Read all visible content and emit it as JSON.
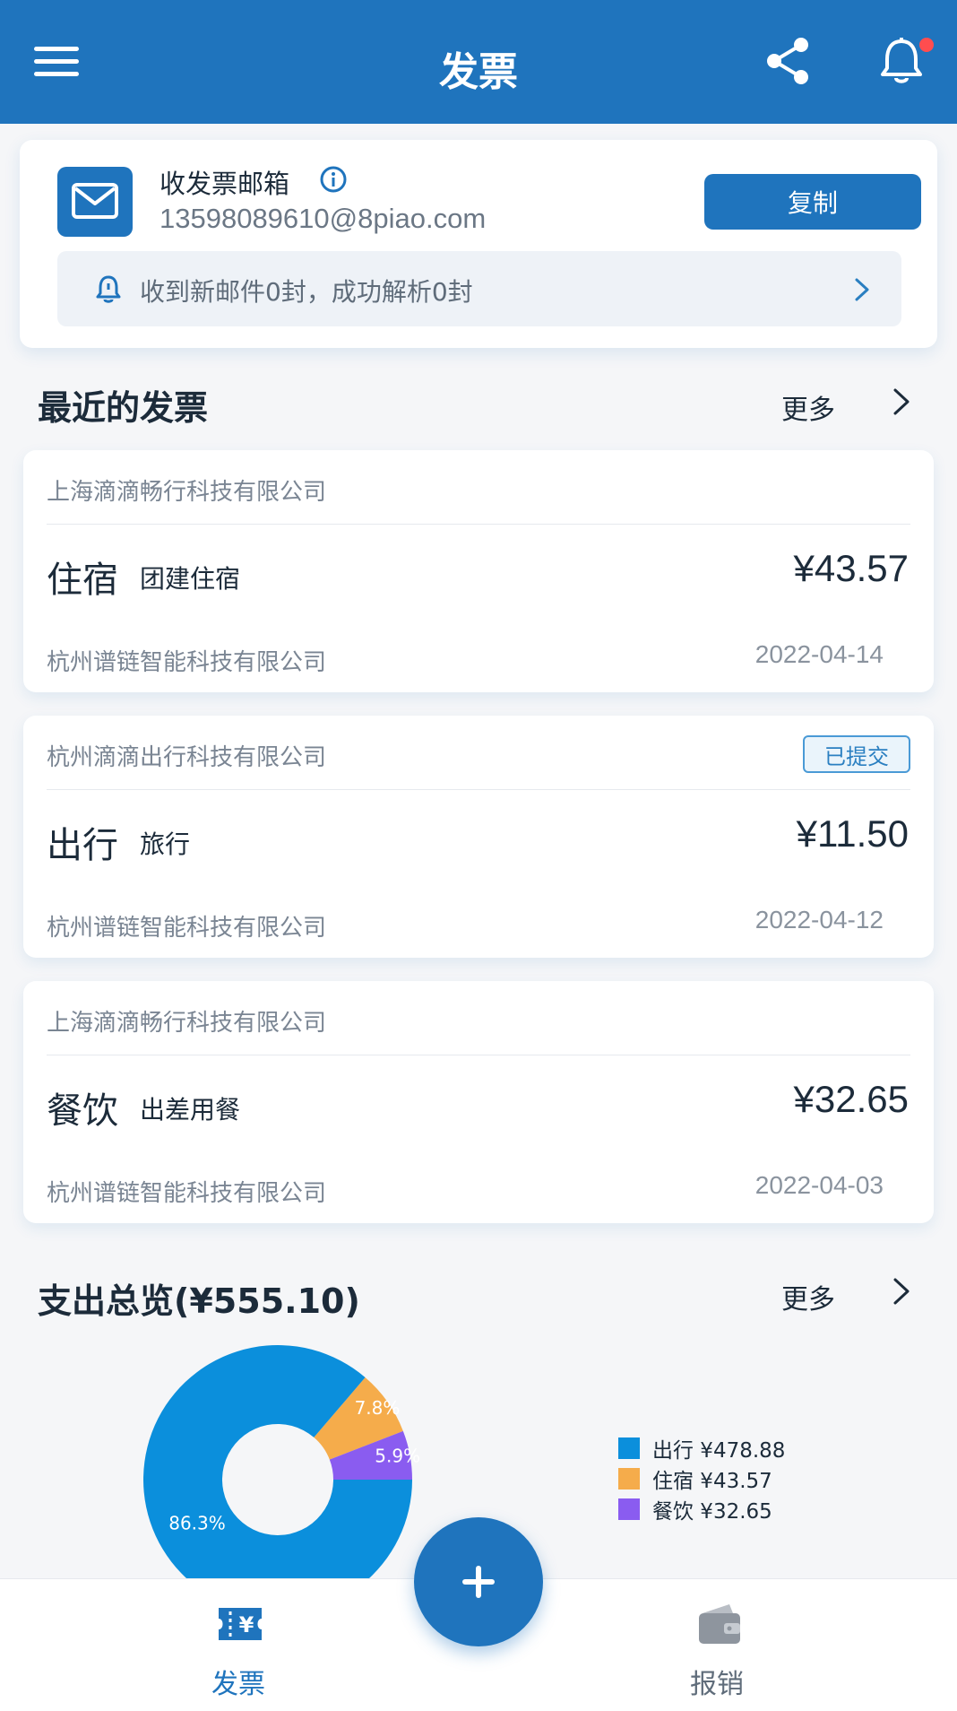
{
  "header": {
    "title": "发票",
    "menu_icon": "hamburger-menu-icon",
    "share_icon": "share-icon",
    "bell_icon": "bell-icon",
    "brand_color": "#1f74bd"
  },
  "mailbox": {
    "title": "收发票邮箱",
    "address": "13598089610@8piao.com",
    "copy_label": "复制",
    "notice": "收到新邮件0封，成功解析0封"
  },
  "recent": {
    "title": "最近的发票",
    "more_label": "更多",
    "invoices": [
      {
        "seller": "上海滴滴畅行科技有限公司",
        "category": "住宿",
        "description": "团建住宿",
        "amount": "¥43.57",
        "buyer": "杭州谱链智能科技有限公司",
        "date": "2022-04-14",
        "status": ""
      },
      {
        "seller": "杭州滴滴出行科技有限公司",
        "category": "出行",
        "description": "旅行",
        "amount": "¥11.50",
        "buyer": "杭州谱链智能科技有限公司",
        "date": "2022-04-12",
        "status": "已提交"
      },
      {
        "seller": "上海滴滴畅行科技有限公司",
        "category": "餐饮",
        "description": "出差用餐",
        "amount": "¥32.65",
        "buyer": "杭州谱链智能科技有限公司",
        "date": "2022-04-03",
        "status": ""
      }
    ]
  },
  "overview": {
    "title": "支出总览(¥555.10)",
    "more_label": "更多"
  },
  "chart_data": {
    "type": "pie",
    "categories": [
      "出行",
      "住宿",
      "餐饮"
    ],
    "values": [
      478.88,
      43.57,
      32.65
    ],
    "percent_labels": [
      "86.3%",
      "7.8%",
      "5.9%"
    ],
    "legend_labels": [
      "出行 ¥478.88",
      "住宿 ¥43.57",
      "餐饮 ¥32.65"
    ],
    "colors": [
      "#0b8fdc",
      "#f5ac4b",
      "#8a5cf0"
    ],
    "legend_position": "right"
  },
  "bottom_nav": {
    "tabs": [
      {
        "label": "发票",
        "icon": "invoice-yen-icon",
        "active": true,
        "color": "#1f74bd"
      },
      {
        "label": "报销",
        "icon": "wallet-icon",
        "active": false,
        "color": "#5f6c7a"
      }
    ],
    "fab_icon": "plus-icon"
  }
}
